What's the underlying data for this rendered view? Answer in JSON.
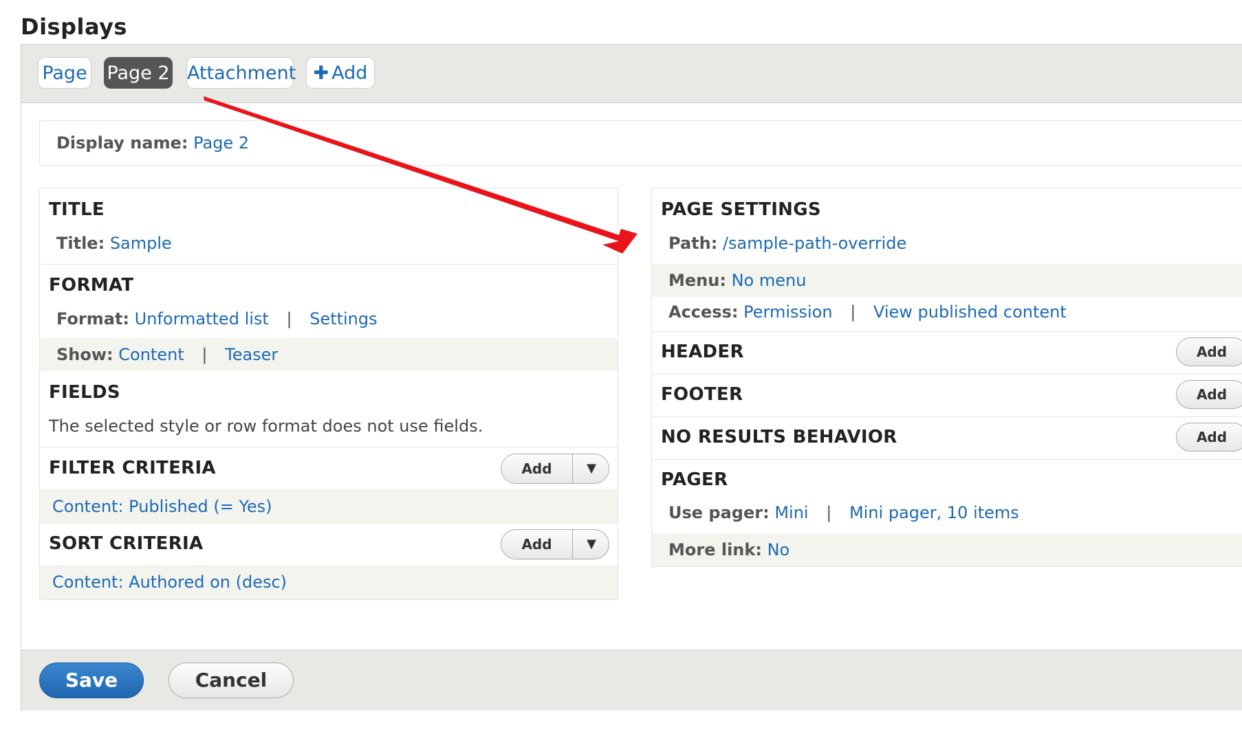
{
  "heading": "Displays",
  "tabs": [
    {
      "label": "Page",
      "active": false
    },
    {
      "label": "Page 2",
      "active": true
    },
    {
      "label": "Attachment",
      "active": false
    },
    {
      "label": "Add",
      "icon": "plus-icon"
    }
  ],
  "display_name": {
    "label": "Display name:",
    "value": "Page 2"
  },
  "left": {
    "title": {
      "heading": "TITLE",
      "label": "Title:",
      "value": "Sample"
    },
    "format": {
      "heading": "FORMAT",
      "format_label": "Format:",
      "format_value": "Unformatted list",
      "settings": "Settings",
      "show_label": "Show:",
      "show_value": "Content",
      "teaser": "Teaser"
    },
    "fields": {
      "heading": "FIELDS",
      "note": "The selected style or row format does not use fields."
    },
    "filter": {
      "heading": "FILTER CRITERIA",
      "add": "Add",
      "item": "Content: Published (= Yes)"
    },
    "sort": {
      "heading": "SORT CRITERIA",
      "add": "Add",
      "item": "Content: Authored on (desc)"
    }
  },
  "right": {
    "page_settings": {
      "heading": "PAGE SETTINGS",
      "path_label": "Path:",
      "path_value": "/sample-path-override",
      "menu_label": "Menu:",
      "menu_value": "No menu",
      "access_label": "Access:",
      "access_value": "Permission",
      "access_extra": "View published content"
    },
    "header": {
      "heading": "HEADER",
      "add": "Add"
    },
    "footer": {
      "heading": "FOOTER",
      "add": "Add"
    },
    "no_results": {
      "heading": "NO RESULTS BEHAVIOR",
      "add": "Add"
    },
    "pager": {
      "heading": "PAGER",
      "use_label": "Use pager:",
      "use_value": "Mini",
      "use_extra": "Mini pager, 10 items",
      "more_label": "More link:",
      "more_value": "No"
    }
  },
  "actions": {
    "save": "Save",
    "cancel": "Cancel"
  },
  "colors": {
    "link": "#1d69b3",
    "annotation_arrow": "#e8141a",
    "save_button": "#1f66b0"
  }
}
